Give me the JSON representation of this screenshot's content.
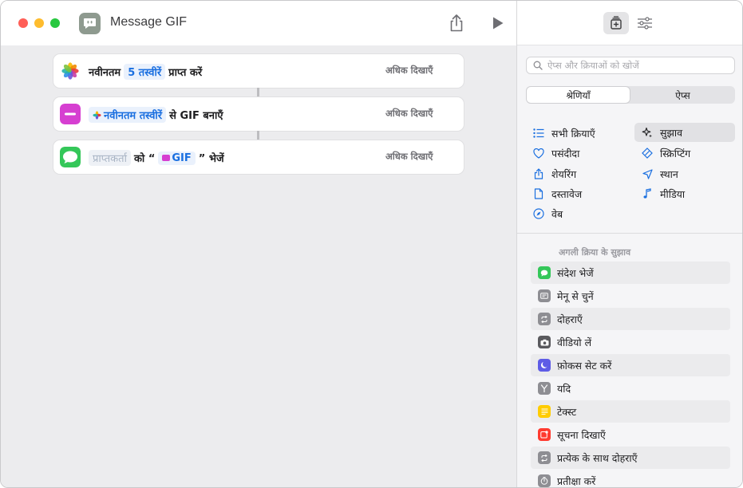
{
  "window": {
    "title": "Message GIF"
  },
  "actions": [
    {
      "parts": [
        "नवीनतम",
        "5 तस्वीरें",
        "प्राप्त करें"
      ],
      "more": "अधिक दिखाएँ"
    },
    {
      "parts": [
        "नवीनतम तस्वीरें",
        "से GIF बनाएँ"
      ],
      "more": "अधिक दिखाएँ"
    },
    {
      "parts": [
        "प्राप्तकर्ता",
        "को “",
        "GIF",
        "” भेजें"
      ],
      "more": "अधिक दिखाएँ"
    }
  ],
  "search": {
    "placeholder": "ऐप्स और क्रियाओं को खोजें"
  },
  "segments": {
    "categories": "श्रेणियाँ",
    "apps": "ऐप्स"
  },
  "categories": {
    "all_actions": "सभी क्रियाएँ",
    "suggestions": "सुझाव",
    "favorites": "पसंदीदा",
    "scripting": "स्क्रिप्टिंग",
    "sharing": "शेयरिंग",
    "location": "स्थान",
    "documents": "दस्तावेज",
    "media": "मीडिया",
    "web": "वेब"
  },
  "suggestions_header": "अगली क्रिया के सुझाव",
  "suggestions": [
    {
      "label": "संदेश भेजें",
      "icon": "message-icon",
      "color": "#34c759"
    },
    {
      "label": "मेनू से चुनें",
      "icon": "menu-icon",
      "color": "#8e8e93"
    },
    {
      "label": "दोहराएँ",
      "icon": "repeat-icon",
      "color": "#8e8e93"
    },
    {
      "label": "वीडियो लें",
      "icon": "camera-icon",
      "color": "#5a5a5e"
    },
    {
      "label": "फ़ोकस सेट करें",
      "icon": "moon-icon",
      "color": "#5e5ce6"
    },
    {
      "label": "यदि",
      "icon": "branch-icon",
      "color": "#8e8e93"
    },
    {
      "label": "टेक्स्ट",
      "icon": "text-icon",
      "color": "#ffcc00"
    },
    {
      "label": "सूचना दिखाएँ",
      "icon": "notification-icon",
      "color": "#ff3b30"
    },
    {
      "label": "प्रत्येक के साथ दोहराएँ",
      "icon": "repeat-each-icon",
      "color": "#8e8e93"
    },
    {
      "label": "प्रतीक्षा करें",
      "icon": "timer-icon",
      "color": "#8e8e93"
    }
  ],
  "colors": {
    "accent": "#1a6fe0",
    "selected_row": "#e1e1e4"
  }
}
